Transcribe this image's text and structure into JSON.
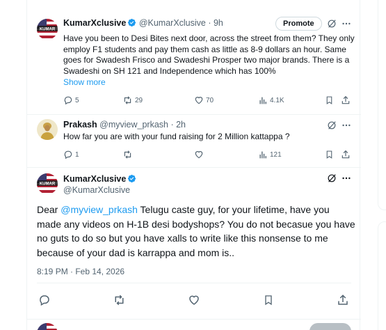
{
  "reply1": {
    "name": "KumarXclusive",
    "handle_time": "@KumarXclusive · 9h",
    "promote_label": "Promote",
    "text": "Have you been to Desi Bites next door, across the street from them? They only employ F1 students and pay them cash as little as 8-9 dollars an hour. Same goes for Swadesh Frisco and Swadeshi Prosper two major brands. There is a Swadeshi on SH 121 and Independence which has 100%",
    "show_more": "Show more",
    "avatar_text": "KUMAR",
    "replies": "5",
    "reposts": "29",
    "likes": "70",
    "views": "4.1K"
  },
  "reply2": {
    "name": "Prakash",
    "handle_time": "@myview_prkash · 2h",
    "text": "How far you are with your fund raising for 2 Million kattappa ?",
    "replies": "1",
    "reposts": "",
    "likes": "",
    "views": "121"
  },
  "main": {
    "name": "KumarXclusive",
    "handle": "@KumarXclusive",
    "avatar_text": "KUMAR",
    "text_prefix": "Dear ",
    "mention": "@myview_prkash",
    "text_rest": " Telugu caste guy, for your lifetime, have you made any videos on H-1B desi bodyshops? You do not becasue you have no guts to do so but you have xalls to write like this nonsense to me because of your dad is karrappa and mom is..",
    "timestamp": "8:19 PM · Feb 14, 2026"
  },
  "colors": {
    "accent": "#1d9bf0",
    "secondary": "#536471",
    "border": "#eff3f4"
  },
  "icons": [
    "grok-icon",
    "more-icon",
    "reply-icon",
    "repost-icon",
    "like-icon",
    "views-icon",
    "bookmark-icon",
    "share-icon",
    "verified-icon"
  ]
}
